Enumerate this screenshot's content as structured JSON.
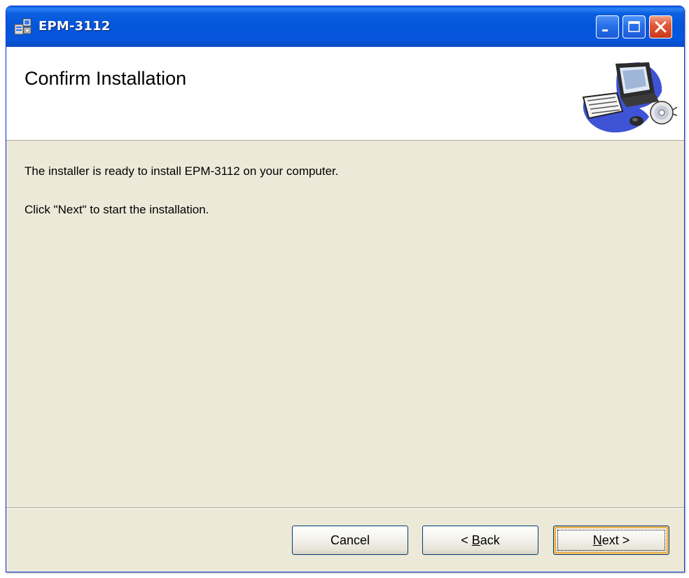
{
  "window": {
    "title": "EPM-3112",
    "title_icon": "installer-icon",
    "controls": {
      "minimize_icon": "minimize-icon",
      "maximize_icon": "maximize-icon",
      "close_icon": "close-icon"
    }
  },
  "header": {
    "title": "Confirm Installation",
    "graphic": "computer-cd-icon"
  },
  "body": {
    "line1": "The installer is ready to install EPM-3112 on your computer.",
    "line2": "Click \"Next\" to start the installation."
  },
  "buttons": {
    "cancel": {
      "label": "Cancel"
    },
    "back": {
      "prefix": "< ",
      "mnemonic": "B",
      "rest": "ack"
    },
    "next": {
      "mnemonic": "N",
      "rest": "ext >"
    }
  },
  "colors": {
    "titlebar": "#0455d8",
    "close_button": "#e25a3a",
    "dialog_background": "#ece9d8",
    "header_background": "#ffffff"
  }
}
